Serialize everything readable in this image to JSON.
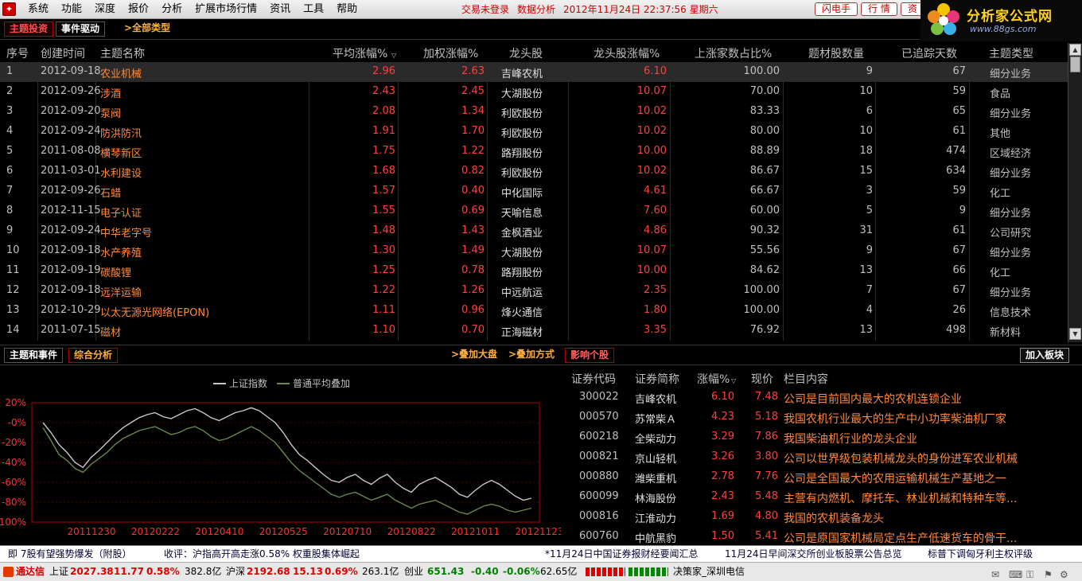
{
  "menubar": {
    "items": [
      "系统",
      "功能",
      "深度",
      "报价",
      "分析",
      "扩展市场行情",
      "资讯",
      "工具",
      "帮助"
    ],
    "status_login": "交易未登录",
    "status_mode": "数据分析",
    "status_datetime": "2012年11月24日  22:37:56  星期六",
    "buttons": [
      "闪电手",
      "行 情",
      "资"
    ]
  },
  "logo": {
    "title": "分析家公式网",
    "url": "www.88gs.com"
  },
  "tabs_top": {
    "theme": "主题投资",
    "event": "事件驱动",
    "all_types": ">全部类型"
  },
  "table": {
    "headers": [
      "序号",
      "创建时间",
      "主题名称",
      "平均涨幅%",
      "加权涨幅%",
      "龙头股",
      "龙头股涨幅%",
      "上涨家数占比%",
      "题材股数量",
      "已追踪天数",
      "主题类型"
    ],
    "rows": [
      [
        "1",
        "2012-09-18",
        "农业机械",
        "2.96",
        "2.63",
        "吉峰农机",
        "6.10",
        "100.00",
        "9",
        "67",
        "细分业务"
      ],
      [
        "2",
        "2012-09-26",
        "涉酒",
        "2.43",
        "2.45",
        "大湖股份",
        "10.07",
        "70.00",
        "10",
        "59",
        "食品"
      ],
      [
        "3",
        "2012-09-20",
        "泵阀",
        "2.08",
        "1.34",
        "利欧股份",
        "10.02",
        "83.33",
        "6",
        "65",
        "细分业务"
      ],
      [
        "4",
        "2012-09-24",
        "防洪防汛",
        "1.91",
        "1.70",
        "利欧股份",
        "10.02",
        "80.00",
        "10",
        "61",
        "其他"
      ],
      [
        "5",
        "2011-08-08",
        "横琴新区",
        "1.75",
        "1.22",
        "路翔股份",
        "10.00",
        "88.89",
        "18",
        "474",
        "区域经济"
      ],
      [
        "6",
        "2011-03-01",
        "水利建设",
        "1.68",
        "0.82",
        "利欧股份",
        "10.02",
        "86.67",
        "15",
        "634",
        "细分业务"
      ],
      [
        "7",
        "2012-09-26",
        "石蜡",
        "1.57",
        "0.40",
        "中化国际",
        "4.61",
        "66.67",
        "3",
        "59",
        "化工"
      ],
      [
        "8",
        "2012-11-15",
        "电子认证",
        "1.55",
        "0.69",
        "天喻信息",
        "7.60",
        "60.00",
        "5",
        "9",
        "细分业务"
      ],
      [
        "9",
        "2012-09-24",
        "中华老字号",
        "1.48",
        "1.43",
        "金枫酒业",
        "4.86",
        "90.32",
        "31",
        "61",
        "公司研究"
      ],
      [
        "10",
        "2012-09-18",
        "水产养殖",
        "1.30",
        "1.49",
        "大湖股份",
        "10.07",
        "55.56",
        "9",
        "67",
        "细分业务"
      ],
      [
        "11",
        "2012-09-19",
        "碳酸锂",
        "1.25",
        "0.78",
        "路翔股份",
        "10.00",
        "84.62",
        "13",
        "66",
        "化工"
      ],
      [
        "12",
        "2012-09-18",
        "远洋运输",
        "1.22",
        "1.26",
        "中远航运",
        "2.35",
        "100.00",
        "7",
        "67",
        "细分业务"
      ],
      [
        "13",
        "2012-10-29",
        "以太无源光网络(EPON)",
        "1.11",
        "0.96",
        "烽火通信",
        "1.80",
        "100.00",
        "4",
        "26",
        "信息技术"
      ],
      [
        "14",
        "2011-07-15",
        "磁材",
        "1.10",
        "0.70",
        "正海磁材",
        "3.35",
        "76.92",
        "13",
        "498",
        "新材料"
      ]
    ]
  },
  "tabs_bottom": {
    "theme_event": "主题和事件",
    "analysis": "综合分析",
    "overlay_index": ">叠加大盘",
    "overlay_mode": ">叠加方式",
    "stocks": "影响个股",
    "add_block": "加入板块"
  },
  "chart_data": {
    "type": "line",
    "legend": [
      "上证指数",
      "普通平均叠加"
    ],
    "y_ticks": [
      "20%",
      "-0%",
      "-20%",
      "-40%",
      "-60%",
      "-80%",
      "-100%"
    ],
    "ylim": [
      -100,
      20
    ],
    "x_ticks": [
      "20111230",
      "20120222",
      "20120410",
      "20120525",
      "20120710",
      "20120822",
      "20121011",
      "20121123"
    ],
    "series": [
      {
        "name": "上证指数",
        "color": "#c8c8c8",
        "values": [
          0,
          -10,
          -22,
          -30,
          -40,
          -45,
          -35,
          -28,
          -20,
          -12,
          -5,
          0,
          5,
          8,
          10,
          6,
          4,
          8,
          12,
          14,
          10,
          5,
          2,
          6,
          10,
          12,
          15,
          12,
          6,
          0,
          -10,
          -22,
          -32,
          -38,
          -45,
          -52,
          -58,
          -60,
          -55,
          -52,
          -58,
          -62,
          -56,
          -52,
          -60,
          -66,
          -70,
          -62,
          -58,
          -55,
          -60,
          -65,
          -72,
          -75,
          -68,
          -62,
          -58,
          -62,
          -68,
          -74,
          -78,
          -76
        ]
      },
      {
        "name": "普通平均叠加",
        "color": "#6a8a4a",
        "values": [
          -5,
          -18,
          -32,
          -38,
          -46,
          -50,
          -42,
          -36,
          -30,
          -22,
          -16,
          -12,
          -8,
          -6,
          -4,
          -8,
          -12,
          -10,
          -6,
          -4,
          -8,
          -14,
          -18,
          -16,
          -12,
          -8,
          -4,
          -8,
          -14,
          -20,
          -30,
          -40,
          -48,
          -54,
          -60,
          -66,
          -72,
          -75,
          -72,
          -70,
          -74,
          -78,
          -75,
          -72,
          -78,
          -82,
          -86,
          -82,
          -80,
          -78,
          -82,
          -86,
          -90,
          -92,
          -88,
          -84,
          -82,
          -84,
          -88,
          -90,
          -88,
          -86
        ]
      }
    ]
  },
  "stocks": {
    "headers": [
      "证券代码",
      "证券简称",
      "涨幅%",
      "现价",
      "栏目内容"
    ],
    "rows": [
      [
        "300022",
        "吉峰农机",
        "6.10",
        "7.48",
        "公司是目前国内最大的农机连锁企业"
      ],
      [
        "000570",
        "苏常柴Ａ",
        "4.23",
        "5.18",
        "我国农机行业最大的生产中小功率柴油机厂家"
      ],
      [
        "600218",
        "全柴动力",
        "3.29",
        "7.86",
        "我国柴油机行业的龙头企业"
      ],
      [
        "000821",
        "京山轻机",
        "3.26",
        "3.80",
        "公司以世界级包装机械龙头的身份进军农业机械"
      ],
      [
        "000880",
        "潍柴重机",
        "2.78",
        "7.76",
        "公司是全国最大的农用运输机械生产基地之一"
      ],
      [
        "600099",
        "林海股份",
        "2.43",
        "5.48",
        "主营有内燃机、摩托车、林业机械和特种车等..."
      ],
      [
        "000816",
        "江淮动力",
        "1.69",
        "4.80",
        "我国的农机装备龙头"
      ],
      [
        "600760",
        "中航黑豹",
        "1.50",
        "5.41",
        "公司是原国家机械局定点生产低速货车的骨干..."
      ]
    ]
  },
  "ticker": {
    "items": [
      "即 7股有望强势爆发（附股）",
      "收评：沪指高开高走涨0.58% 权重股集体崛起",
      "*11月24日中国证券报财经要闻汇总",
      "11月24日早间深交所创业板股票公告总览",
      "标普下调匈牙利主权评级"
    ]
  },
  "statusbar": {
    "brand": "通达信",
    "sh_label": "上证",
    "sh_val": "2027.38",
    "sh_chg": "11.77",
    "sh_pct": "0.58%",
    "sh_amt": "382.8亿",
    "hs_label": "沪深",
    "hs_val": "2192.68",
    "hs_chg": "15.13",
    "hs_pct": "0.69%",
    "hs_amt": "263.1亿",
    "cy_label": "创业",
    "cy_val": "651.43",
    "cy_chg": "-0.40",
    "cy_pct": "-0.06%",
    "cy_amt": "62.65亿",
    "server": "决策家_深圳电信"
  }
}
